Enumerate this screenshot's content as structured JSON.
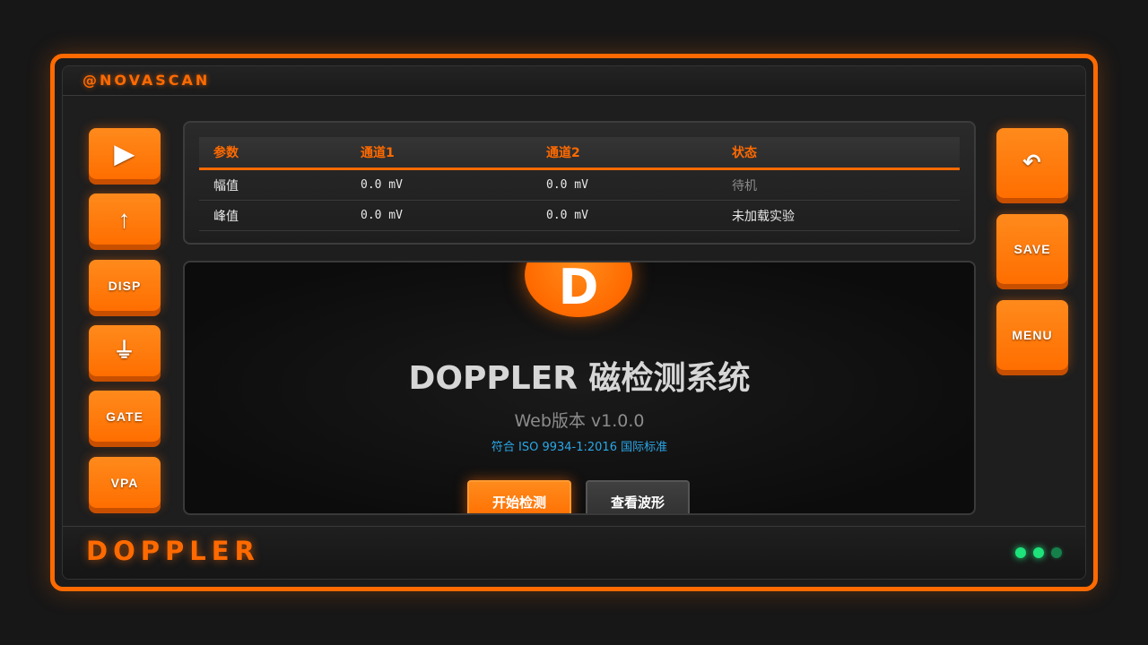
{
  "brand": {
    "tag": "@NOVASCAN",
    "footer_name": "DOPPLER",
    "accent_color": "#ff6a00"
  },
  "left_buttons": [
    {
      "label": "▶",
      "icon": "play-icon"
    },
    {
      "label": "↑",
      "icon": "arrow-up-icon"
    },
    {
      "label": "DISP"
    },
    {
      "label": "⏚",
      "icon": "ground-icon"
    },
    {
      "label": "GATE"
    },
    {
      "label": "VPA"
    }
  ],
  "right_buttons": [
    {
      "label": "↶",
      "icon": "undo-icon"
    },
    {
      "label": "SAVE"
    },
    {
      "label": "MENU"
    }
  ],
  "table": {
    "headers": [
      "参数",
      "通道1",
      "通道2",
      "状态"
    ],
    "rows": [
      [
        "幅值",
        "0.0 mV",
        "0.0 mV",
        "待机"
      ],
      [
        "峰值",
        "0.0 mV",
        "0.0 mV",
        "未加载实验"
      ]
    ]
  },
  "main": {
    "logo_letter": "D",
    "title": "DOPPLER 磁检测系统",
    "version": "Web版本 v1.0.0",
    "standard": "符合 ISO 9934-1:2016 国际标准",
    "start_button": "开始检测",
    "wave_button": "查看波形"
  },
  "status_leds": [
    {
      "state": "on",
      "color": "#1ee37a"
    },
    {
      "state": "on",
      "color": "#1ee37a"
    },
    {
      "state": "dim",
      "color": "#15804a"
    }
  ]
}
